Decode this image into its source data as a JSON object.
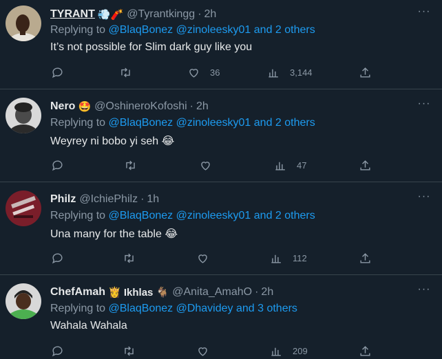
{
  "tweets": [
    {
      "name": "TYRANT",
      "name_emoji": "💨🧨",
      "handle": "@Tyrantkingg",
      "separator": "·",
      "time": "2h",
      "reply_prefix": "Replying to",
      "reply_mentions": "@BlaqBonez @zinoleesky01 and 2 others",
      "text": "It’s not possible for Slim dark guy like you",
      "likes": "36",
      "views": "3,144",
      "avatar_colors": {
        "bg": "#b9aa8f",
        "face": "#3a2418",
        "shirt": "#e8e4dc"
      }
    },
    {
      "name": "Nero",
      "name_emoji": "🤩",
      "handle": "@OshineroKofoshi",
      "separator": "·",
      "time": "2h",
      "reply_prefix": "Replying to",
      "reply_mentions": "@BlaqBonez @zinoleesky01 and 2 others",
      "text": "Weyrey ni bobo yi seh 😂",
      "likes": "",
      "views": "47",
      "avatar_colors": {
        "bg": "#d9d9d9",
        "face": "#4a4a4a",
        "shirt": "#2b2b2b"
      }
    },
    {
      "name": "Philz",
      "name_emoji": "",
      "handle": "@IchiePhilz",
      "separator": "·",
      "time": "1h",
      "reply_prefix": "Replying to",
      "reply_mentions": "@BlaqBonez @zinoleesky01 and 2 others",
      "text": "Una many for the table 😂",
      "likes": "",
      "views": "112",
      "avatar_colors": {
        "bg": "#7a1e2a",
        "face": "#c8b8b8",
        "shirt": "#3a0f16"
      }
    },
    {
      "name": "ChefAmah",
      "name_emoji": "👸 Ikhlas 🐐",
      "handle": "@Anita_AmahO",
      "separator": "·",
      "time": "2h",
      "reply_prefix": "Replying to",
      "reply_mentions": "@BlaqBonez @Dhavidey and 3 others",
      "text": "Wahala Wahala",
      "likes": "",
      "views": "209",
      "avatar_colors": {
        "bg": "#d8d8d8",
        "face": "#4a2e1e",
        "shirt": "#4caf50"
      }
    }
  ],
  "more_label": "···"
}
